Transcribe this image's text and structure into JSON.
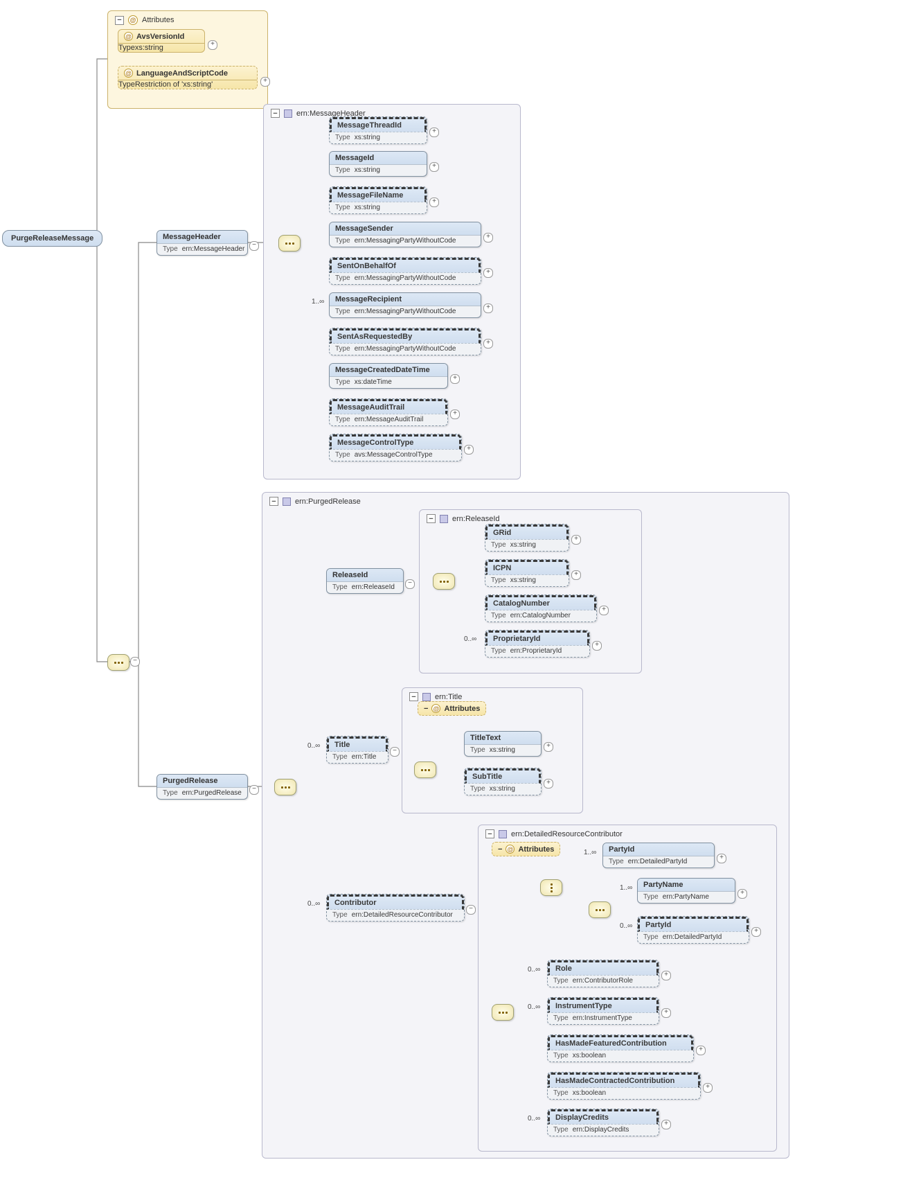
{
  "root": {
    "name": "PurgeReleaseMessage"
  },
  "attrGroup": {
    "title": "Attributes",
    "items": [
      {
        "name": "AvsVersionId",
        "typeLabel": "Type",
        "type": "xs:string",
        "optional": false
      },
      {
        "name": "LanguageAndScriptCode",
        "typeLabel": "Type",
        "type": "Restriction of 'xs:string'",
        "optional": true
      }
    ]
  },
  "messageHeader": {
    "name": "MessageHeader",
    "typeLabel": "Type",
    "type": "ern:MessageHeader",
    "groupTitle": "ern:MessageHeader",
    "children": [
      {
        "name": "MessageThreadId",
        "type": "xs:string",
        "optional": true
      },
      {
        "name": "MessageId",
        "type": "xs:string",
        "optional": false
      },
      {
        "name": "MessageFileName",
        "type": "xs:string",
        "optional": true
      },
      {
        "name": "MessageSender",
        "type": "ern:MessagingPartyWithoutCode",
        "optional": false
      },
      {
        "name": "SentOnBehalfOf",
        "type": "ern:MessagingPartyWithoutCode",
        "optional": true
      },
      {
        "name": "MessageRecipient",
        "type": "ern:MessagingPartyWithoutCode",
        "optional": false,
        "card": "1..∞"
      },
      {
        "name": "SentAsRequestedBy",
        "type": "ern:MessagingPartyWithoutCode",
        "optional": true
      },
      {
        "name": "MessageCreatedDateTime",
        "type": "xs:dateTime",
        "optional": false
      },
      {
        "name": "MessageAuditTrail",
        "type": "ern:MessageAuditTrail",
        "optional": true
      },
      {
        "name": "MessageControlType",
        "type": "avs:MessageControlType",
        "optional": true
      }
    ]
  },
  "purgedRelease": {
    "name": "PurgedRelease",
    "typeLabel": "Type",
    "type": "ern:PurgedRelease",
    "groupTitle": "ern:PurgedRelease",
    "releaseId": {
      "name": "ReleaseId",
      "type": "ern:ReleaseId",
      "groupTitle": "ern:ReleaseId",
      "children": [
        {
          "name": "GRid",
          "type": "xs:string",
          "optional": true
        },
        {
          "name": "ICPN",
          "type": "xs:string",
          "optional": true
        },
        {
          "name": "CatalogNumber",
          "type": "ern:CatalogNumber",
          "optional": true
        },
        {
          "name": "ProprietaryId",
          "type": "ern:ProprietaryId",
          "optional": true,
          "card": "0..∞"
        }
      ]
    },
    "title": {
      "name": "Title",
      "type": "ern:Title",
      "card": "0..∞",
      "groupTitle": "ern:Title",
      "attrLabel": "Attributes",
      "children": [
        {
          "name": "TitleText",
          "type": "xs:string",
          "optional": false
        },
        {
          "name": "SubTitle",
          "type": "xs:string",
          "optional": true
        }
      ]
    },
    "contributor": {
      "name": "Contributor",
      "type": "ern:DetailedResourceContributor",
      "card": "0..∞",
      "groupTitle": "ern:DetailedResourceContributor",
      "attrLabel": "Attributes",
      "choiceA": {
        "name": "PartyId",
        "type": "ern:DetailedPartyId",
        "card": "1..∞"
      },
      "seqB": [
        {
          "name": "PartyName",
          "type": "ern:PartyName",
          "card": "1..∞",
          "optional": false
        },
        {
          "name": "PartyId",
          "type": "ern:DetailedPartyId",
          "card": "0..∞",
          "optional": true
        }
      ],
      "rest": [
        {
          "name": "Role",
          "type": "ern:ContributorRole",
          "card": "0..∞",
          "optional": true
        },
        {
          "name": "InstrumentType",
          "type": "ern:InstrumentType",
          "card": "0..∞",
          "optional": true
        },
        {
          "name": "HasMadeFeaturedContribution",
          "type": "xs:boolean",
          "optional": true
        },
        {
          "name": "HasMadeContractedContribution",
          "type": "xs:boolean",
          "optional": true
        },
        {
          "name": "DisplayCredits",
          "type": "ern:DisplayCredits",
          "card": "0..∞",
          "optional": true
        }
      ]
    }
  },
  "labels": {
    "type": "Type"
  }
}
